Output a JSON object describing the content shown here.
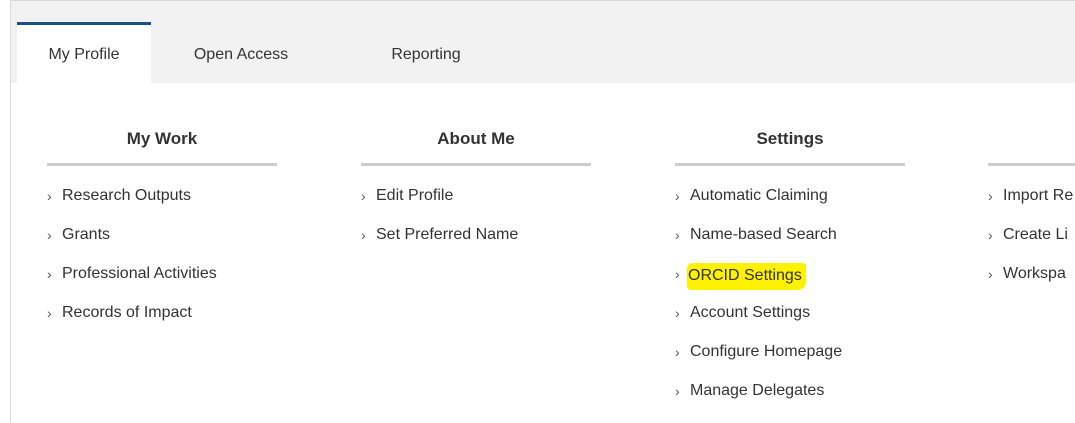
{
  "tabs": [
    {
      "label": "My Profile",
      "active": true
    },
    {
      "label": "Open Access",
      "active": false
    },
    {
      "label": "Reporting",
      "active": false
    }
  ],
  "columns": [
    {
      "heading": "My Work",
      "items": [
        "Research Outputs",
        "Grants",
        "Professional Activities",
        "Records of Impact"
      ]
    },
    {
      "heading": "About Me",
      "items": [
        "Edit Profile",
        "Set Preferred Name"
      ]
    },
    {
      "heading": "Settings",
      "items": [
        "Automatic Claiming",
        "Name-based Search",
        "ORCID Settings",
        "Account Settings",
        "Configure Homepage",
        "Manage Delegates"
      ],
      "highlighted_item": "ORCID Settings"
    },
    {
      "heading": "",
      "items": [
        "Import Re",
        "Create Li",
        "Workspa"
      ]
    }
  ],
  "icons": {
    "list_bullet": "chevron-right-icon"
  },
  "colors": {
    "highlight": "#fff200",
    "active_tab_border": "#1b4f8a",
    "tab_bar_bg": "#f2f2f2"
  }
}
